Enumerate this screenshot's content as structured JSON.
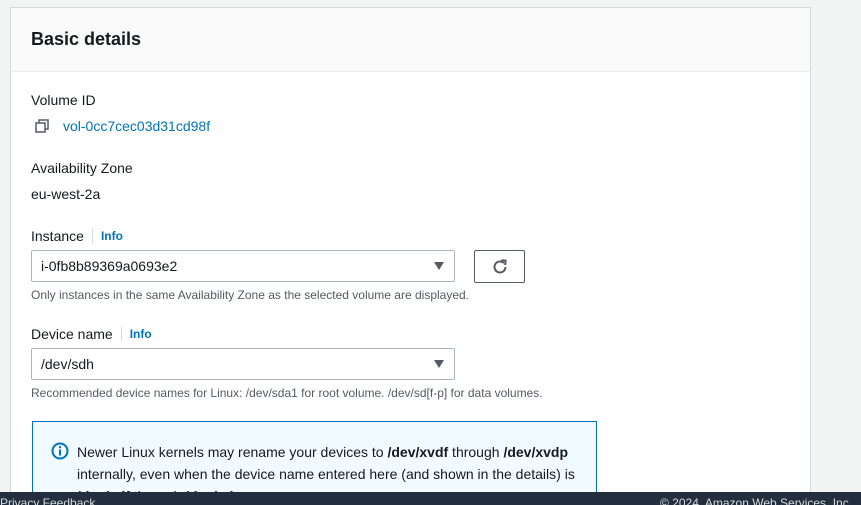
{
  "panel": {
    "title": "Basic details"
  },
  "volume": {
    "label": "Volume ID",
    "value": "vol-0cc7cec03d31cd98f"
  },
  "az": {
    "label": "Availability Zone",
    "value": "eu-west-2a"
  },
  "instance": {
    "label": "Instance",
    "info": "Info",
    "selected": "i-0fb8b89369a0693e2",
    "hint": "Only instances in the same Availability Zone as the selected volume are displayed."
  },
  "device": {
    "label": "Device name",
    "info": "Info",
    "selected": "/dev/sdh",
    "hint": "Recommended device names for Linux: /dev/sda1 for root volume. /dev/sd[f-p] for data volumes."
  },
  "alert": {
    "t1": "Newer Linux kernels may rename your devices to ",
    "b1": "/dev/xvdf",
    "t2": " through ",
    "b2": "/dev/xvdp",
    "t3": " internally, even when the device name entered here (and shown in the details) is ",
    "b3": "/dev/sdf",
    "t4": " through ",
    "b4": "/dev/sdp",
    "t5": "."
  },
  "footer": {
    "left": "Privacy  Feedback",
    "right": "© 2024, Amazon Web Services, Inc."
  }
}
